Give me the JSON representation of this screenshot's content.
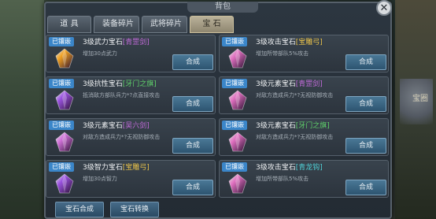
{
  "window": {
    "title": "背包",
    "close_glyph": "✕"
  },
  "tabs": [
    {
      "label": "道 具",
      "active": false
    },
    {
      "label": "装备碎片",
      "active": false
    },
    {
      "label": "武将碎片",
      "active": false
    },
    {
      "label": "宝 石",
      "active": true
    }
  ],
  "badge_label": "已镶嵌",
  "compose_label": "合成",
  "gems": [
    {
      "name": "3级武力宝石",
      "tag": "[青罡剑]",
      "tag_color": "purple",
      "desc": "增加30点武力",
      "gem_color": "#f0a020"
    },
    {
      "name": "3级攻击宝石",
      "tag": "[宝雕弓]",
      "tag_color": "gold",
      "desc": "增加所带部队5%攻击",
      "gem_color": "#e070c0"
    },
    {
      "name": "3级抗性宝石",
      "tag": "[牙门之旗]",
      "tag_color": "green",
      "desc": "抵消敌方部队兵力*?点直接攻击",
      "gem_color": "#9a52e0"
    },
    {
      "name": "3级元素宝石",
      "tag": "[青罡剑]",
      "tag_color": "purple",
      "desc": "对敌方造成兵力*?无视防御攻击",
      "gem_color": "#e070c0"
    },
    {
      "name": "3级元素宝石",
      "tag": "[吴六剑]",
      "tag_color": "purple",
      "desc": "对敌方造成兵力*?无视防御攻击",
      "gem_color": "#d070d8"
    },
    {
      "name": "3级元素宝石",
      "tag": "[牙门之旗]",
      "tag_color": "green",
      "desc": "对敌方造成兵力*?无视防御攻击",
      "gem_color": "#e070c0"
    },
    {
      "name": "3级智力宝石",
      "tag": "[宝雕弓]",
      "tag_color": "gold",
      "desc": "增加30点智力",
      "gem_color": "#9a52e0"
    },
    {
      "name": "3级攻击宝石",
      "tag": "[青龙钩]",
      "tag_color": "cyan",
      "desc": "增加所带部队5%攻击",
      "gem_color": "#e070c0"
    }
  ],
  "bottom_buttons": {
    "compose": "宝石合成",
    "convert": "宝石转换"
  },
  "background_text": "宝圈"
}
